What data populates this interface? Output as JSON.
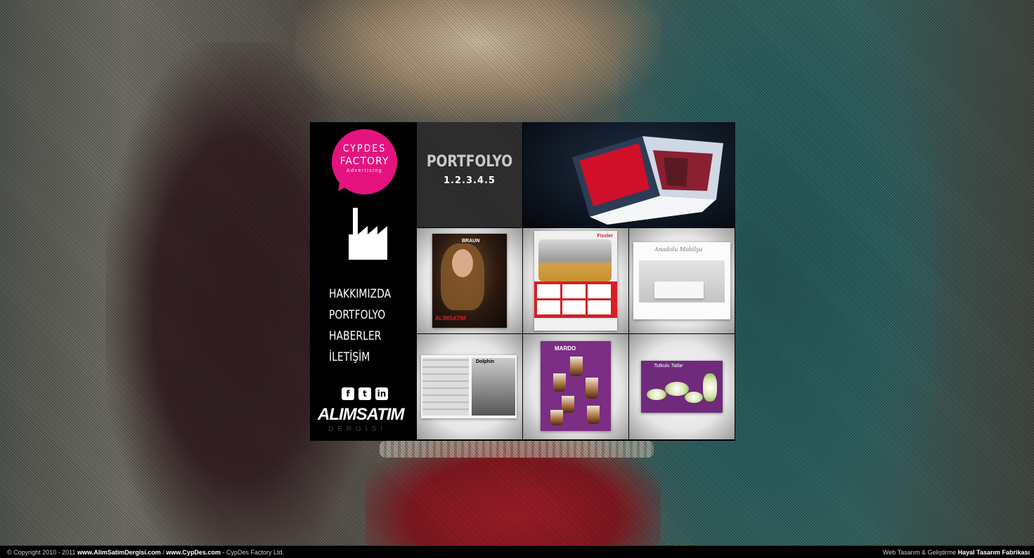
{
  "brand": {
    "logo_line1": "CYPDES",
    "logo_line2": "FACTORY",
    "logo_line3": "Advertising",
    "pink": "#e5137f"
  },
  "nav": {
    "items": [
      {
        "label": "HAKKIMIZDA"
      },
      {
        "label": "PORTFOLYO"
      },
      {
        "label": "HABERLER"
      },
      {
        "label": "İLETİŞİM"
      }
    ]
  },
  "social": {
    "icons": [
      {
        "name": "facebook-icon",
        "glyph": "f"
      },
      {
        "name": "twitter-icon",
        "glyph": "t"
      },
      {
        "name": "linkedin-icon",
        "glyph": "in"
      }
    ]
  },
  "magazine": {
    "title": "ALIMSATIM",
    "subtitle": "DERGİSİ"
  },
  "portfolio": {
    "title": "PORTFOLYO",
    "pages": "1.2.3.4.5"
  },
  "tiles": {
    "t1_brand": "BRAUN",
    "t1_red": "ALIMSATIM",
    "t2_brand": "Fissler",
    "t3_script": "Anadolu Mobilya",
    "t4_tag": "Dolphin",
    "t5_logo": "MARDO",
    "t6_title": "Tutkulu Tatlar"
  },
  "footer": {
    "copyright_prefix": "© Copyright 2010 - 2011",
    "link1": "www.AlimSatimDergisi.com",
    "sep": " / ",
    "link2": "www.CypDes.com",
    "suffix": " - CypDes Factory Ltd.",
    "credit_prefix": "Web Tasarım & Geliştirme",
    "credit_link": "Hayal Tasarım Fabrikası"
  }
}
